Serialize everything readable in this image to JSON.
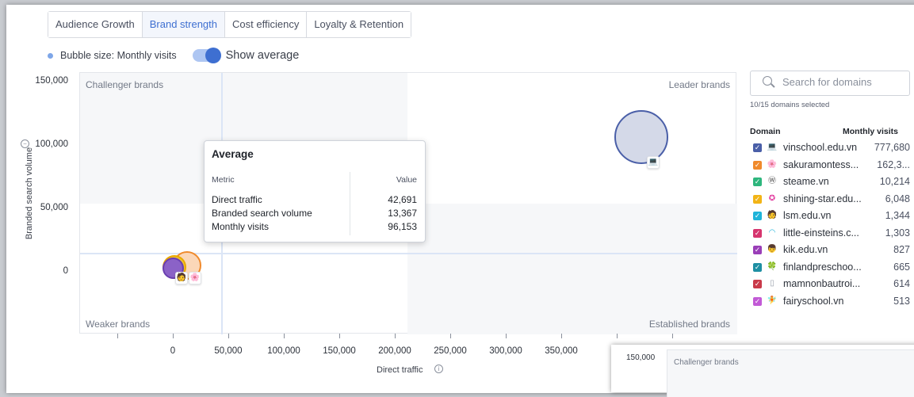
{
  "tabs": [
    {
      "label": "Audience Growth",
      "active": false
    },
    {
      "label": "Brand strength",
      "active": true
    },
    {
      "label": "Cost efficiency",
      "active": false
    },
    {
      "label": "Loyalty & Retention",
      "active": false
    }
  ],
  "legend": {
    "bubble_size_label": "Bubble size: Monthly visits",
    "toggle_label": "Show average",
    "toggle_on": true
  },
  "chart": {
    "y_title": "Branded search volume",
    "x_title": "Direct traffic",
    "y_ticks": [
      "150,000",
      "100,000",
      "50,000",
      "0"
    ],
    "x_ticks": [
      "0",
      "50,000",
      "100,000",
      "150,000",
      "200,000",
      "250,000",
      "300,000",
      "350,000"
    ],
    "quadrants": {
      "top_left": "Challenger brands",
      "top_right": "Leader brands",
      "bottom_left": "Weaker brands",
      "bottom_right": "Established brands"
    }
  },
  "chart_data": {
    "type": "scatter",
    "xlabel": "Direct traffic",
    "ylabel": "Branded search volume",
    "xlim": [
      -50000,
      525000
    ],
    "ylim": [
      -45000,
      150000
    ],
    "average": {
      "x": 42691,
      "y": 13367
    },
    "points": [
      {
        "domain": "vinschool.edu.vn",
        "x": 425000,
        "y": 93000,
        "size": 777680
      },
      {
        "domain": "sakuramontessori",
        "x": 14000,
        "y": 4000,
        "size": 162300
      },
      {
        "domain": "lsm.edu.vn",
        "x": 2000,
        "y": 1000,
        "size": 1344
      }
    ]
  },
  "tooltip": {
    "title": "Average",
    "col_metric": "Metric",
    "col_value": "Value",
    "rows": [
      {
        "metric": "Direct traffic",
        "value": "42,691"
      },
      {
        "metric": "Branded search volume",
        "value": "13,367"
      },
      {
        "metric": "Monthly visits",
        "value": "96,153"
      }
    ]
  },
  "sidebar": {
    "search_placeholder": "Search for domains",
    "selected_count": "10/15 domains selected",
    "col_domain": "Domain",
    "col_visits": "Monthly visits",
    "domains": [
      {
        "name": "vinschool.edu.vn",
        "visits": "777,680",
        "color": "#4a5fa8",
        "icon": "laptop-icon"
      },
      {
        "name": "sakuramontess...",
        "visits": "162,3...",
        "color": "#f08a2c",
        "icon": "sakura-icon"
      },
      {
        "name": "steame.vn",
        "visits": "10,214",
        "color": "#2eb67d",
        "icon": "wordpress-icon"
      },
      {
        "name": "shining-star.edu...",
        "visits": "6,048",
        "color": "#f2b416",
        "icon": "star-icon"
      },
      {
        "name": "lsm.edu.vn",
        "visits": "1,344",
        "color": "#1fb4d9",
        "icon": "person-icon"
      },
      {
        "name": "little-einsteins.c...",
        "visits": "1,303",
        "color": "#d6356e",
        "icon": "rainbow-icon"
      },
      {
        "name": "kik.edu.vn",
        "visits": "827",
        "color": "#9a3fb8",
        "icon": "kid-icon"
      },
      {
        "name": "finlandpreschoo...",
        "visits": "665",
        "color": "#1e8fa3",
        "icon": "leaf-icon"
      },
      {
        "name": "mamnonbautroi...",
        "visits": "614",
        "color": "#c93a4a",
        "icon": "page-icon"
      },
      {
        "name": "fairyschool.vn",
        "visits": "513",
        "color": "#c25ad6",
        "icon": "fairy-icon"
      }
    ]
  },
  "overlay": {
    "y_tick": "150,000",
    "quadrant_label": "Challenger brands"
  }
}
